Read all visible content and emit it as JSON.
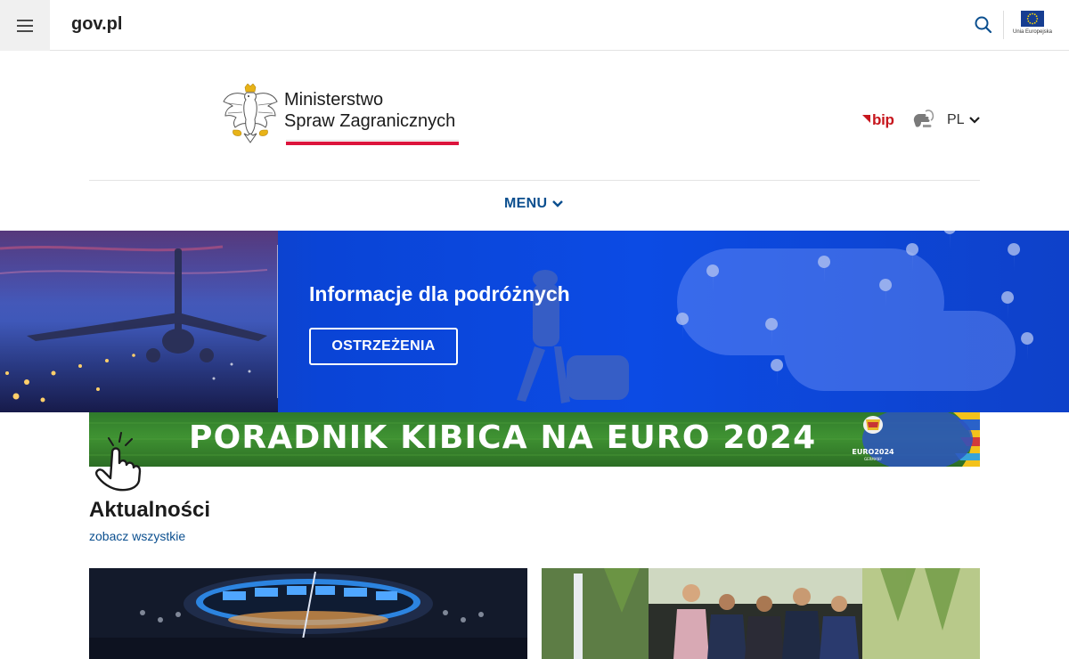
{
  "topbar": {
    "site_label": "gov.pl",
    "eu_label": "Unia Europejska"
  },
  "header": {
    "ministry_line1": "Ministerstwo",
    "ministry_line2": "Spraw Zagranicznych",
    "bip_label": "bip",
    "language": "PL",
    "menu_label": "MENU"
  },
  "banner": {
    "title": "Informacje dla podróżnych",
    "button_label": "OSTRZEŻENIA"
  },
  "promo": {
    "text": "PORADNIK KIBICA NA EURO 2024",
    "logo_line1": "EURO2024",
    "logo_line2": "GERMANY"
  },
  "news": {
    "title": "Aktualności",
    "see_all": "zobacz wszystkie"
  },
  "colors": {
    "accent": "#0b4f8f",
    "brand_red": "#dc143c",
    "banner_blue": "#0c4be4"
  }
}
